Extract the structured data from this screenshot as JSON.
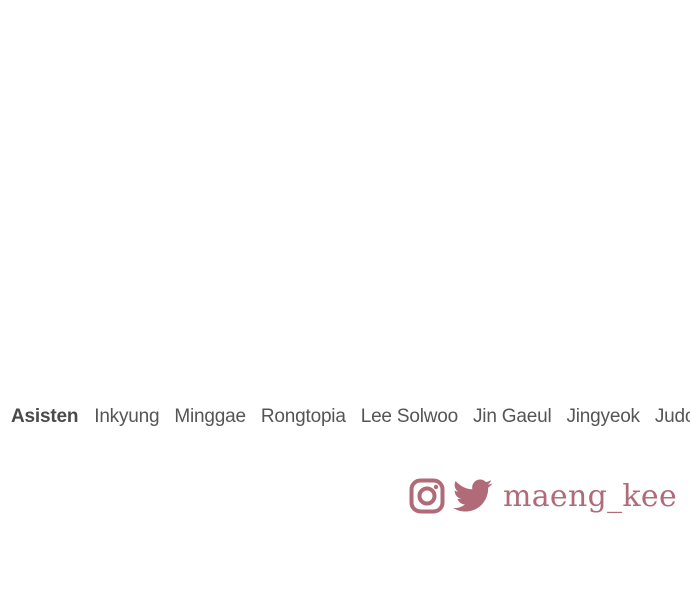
{
  "credits": {
    "title": "Asisten",
    "names": [
      "Inkyung",
      "Minggae",
      "Rongtopia",
      "Lee Solwoo",
      "Jin Gaeul",
      "Jingyeok",
      "Judo"
    ]
  },
  "social": {
    "icons": [
      "instagram-icon",
      "twitter-icon"
    ],
    "handle": "maeng_kee",
    "accent_color": "#b06a78"
  }
}
